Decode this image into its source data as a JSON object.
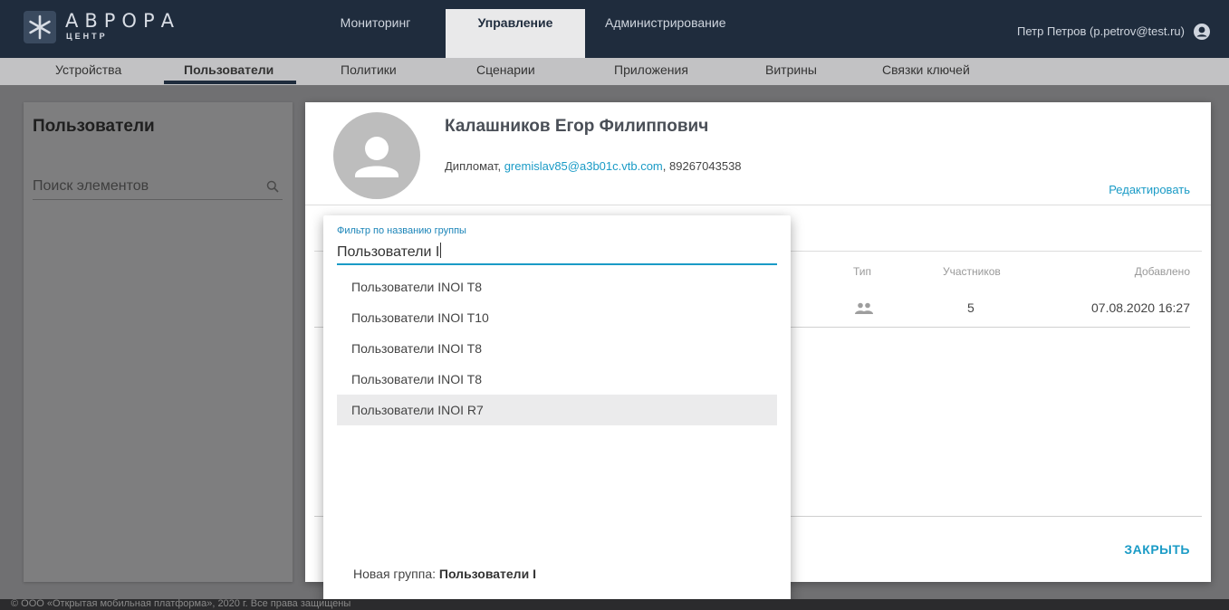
{
  "app": {
    "logo_text": "АВРОРА",
    "logo_sub": "ЦЕНТР",
    "main_tabs": [
      "Мониторинг",
      "Управление",
      "Администрирование"
    ],
    "user": "Петр Петров (p.petrov@test.ru)"
  },
  "sub_tabs": [
    "Устройства",
    "Пользователи",
    "Политики",
    "Сценарии",
    "Приложения",
    "Витрины",
    "Связки ключей"
  ],
  "left_panel": {
    "title": "Пользователи",
    "search_placeholder": "Поиск элементов"
  },
  "profile": {
    "name": "Калашников Егор Филиппович",
    "role": "Дипломат",
    "email": "gremislav85@a3b01c.vtb.com",
    "phone": "89267043538",
    "edit_label": "Редактировать",
    "close_label": "ЗАКРЫТЬ"
  },
  "groups_table": {
    "columns": [
      "Тип",
      "Участников",
      "Добавлено"
    ],
    "rows": [
      {
        "type_icon": "group-icon",
        "members": "5",
        "added": "07.08.2020 16:27"
      }
    ]
  },
  "group_filter": {
    "label": "Фильтр по названию группы",
    "value": "Пользователи I",
    "options": [
      "Пользователи INOI T8",
      "Пользователи INOI T10",
      "Пользователи INOI T8",
      "Пользователи INOI T8",
      "Пользователи INOI R7"
    ],
    "highlighted_index": 4,
    "new_group_prefix": "Новая группа:",
    "new_group_name": "Пользователи I"
  },
  "footer": "© ООО «Открытая мобильная платформа», 2020 г. Все права защищены",
  "colors": {
    "topbar": "#1f2c3d",
    "accent": "#1a9bc6",
    "overlay": "#707072"
  }
}
